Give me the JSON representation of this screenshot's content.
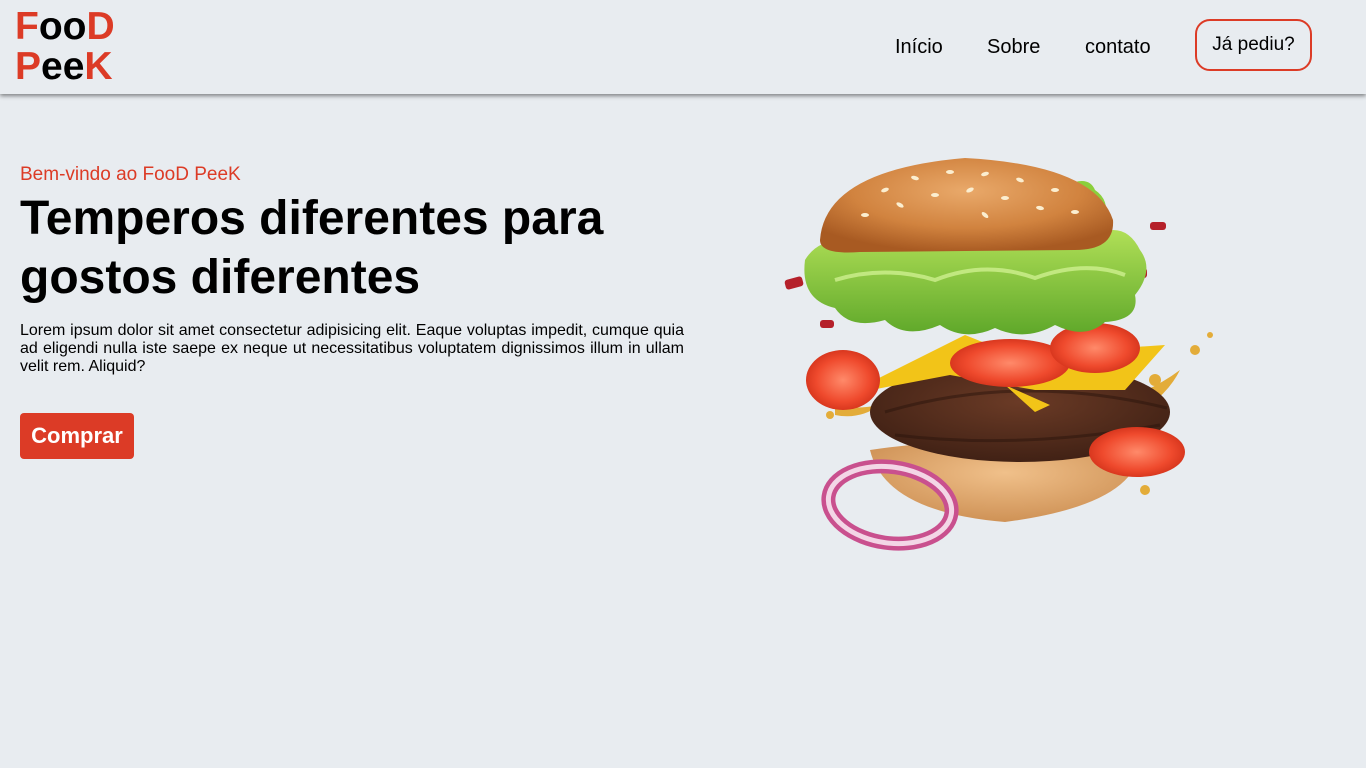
{
  "brand": {
    "line1_a": "F",
    "line1_b": "oo",
    "line1_c": "D",
    "line2_a": "P",
    "line2_b": "ee",
    "line2_c": "K"
  },
  "nav": {
    "items": [
      {
        "label": "Início"
      },
      {
        "label": "Sobre"
      },
      {
        "label": "contato"
      }
    ],
    "order_label": "Já pediu?"
  },
  "hero": {
    "welcome": "Bem-vindo ao FooD PeeK",
    "headline": "Temperos diferentes para gostos diferentes",
    "description": "Lorem ipsum dolor sit amet consectetur adipisicing elit. Eaque voluptas impedit, cumque quia ad eligendi nulla iste saepe ex neque ut necessitatibus voluptatem dignissimos illum in ullam velit rem. Aliquid?",
    "buy_label": "Comprar"
  },
  "colors": {
    "accent": "#dc3b26",
    "background": "#e8ecf0",
    "text": "#000000"
  }
}
